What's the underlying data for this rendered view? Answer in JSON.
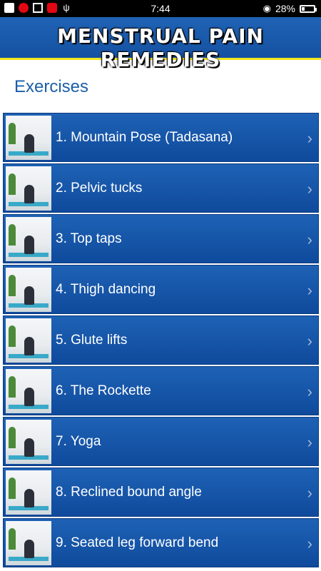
{
  "status": {
    "time": "7:44",
    "battery": "28%",
    "battery_level": 0.28
  },
  "header": {
    "title": "MENSTRUAL PAIN REMEDIES"
  },
  "section": {
    "title": "Exercises"
  },
  "items": [
    {
      "label": "1. Mountain Pose (Tadasana)"
    },
    {
      "label": "2. Pelvic tucks"
    },
    {
      "label": "3. Top taps"
    },
    {
      "label": "4. Thigh dancing"
    },
    {
      "label": "5. Glute lifts"
    },
    {
      "label": "6. The Rockette"
    },
    {
      "label": "7. Yoga"
    },
    {
      "label": "8. Reclined bound angle"
    },
    {
      "label": "9. Seated leg forward bend"
    }
  ],
  "icons": {
    "chevron": "chevron-right-icon"
  }
}
